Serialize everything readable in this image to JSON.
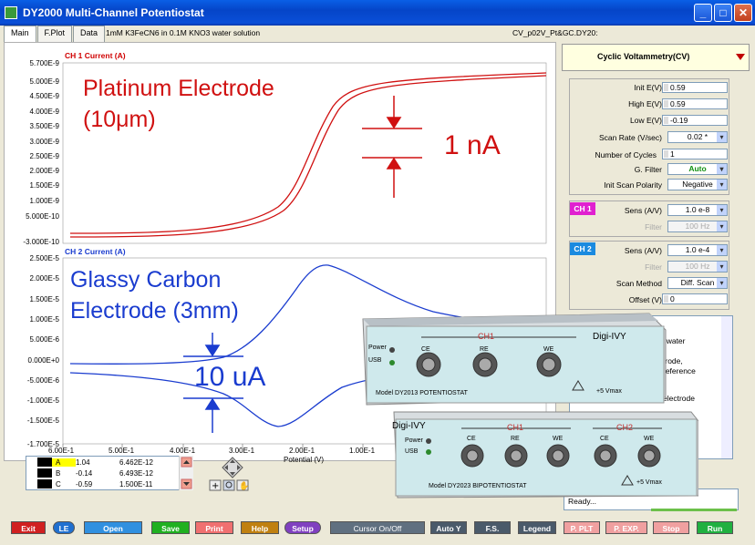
{
  "window": {
    "title": "DY2000 Multi-Channel Potentiostat"
  },
  "tabs": [
    {
      "label": "Main"
    },
    {
      "label": "F.Plot"
    },
    {
      "label": "Data"
    }
  ],
  "header": {
    "description": "1mM K3FeCN6 in 0.1M KNO3 water solution",
    "filename": "CV_p02V_Pt&GC.DY20:"
  },
  "ch1_plot": {
    "label": "CH 1   Current (A)",
    "yticks": [
      "5.700E-9",
      "5.000E-9",
      "4.500E-9",
      "4.000E-9",
      "3.500E-9",
      "3.000E-9",
      "2.500E-9",
      "2.000E-9",
      "1.500E-9",
      "1.000E-9",
      "5.000E-10",
      "-3.000E-10"
    ],
    "annotation_title_1": "Platinum Electrode",
    "annotation_title_2": "(10μm)",
    "scale_label": "1 nA"
  },
  "ch2_plot": {
    "label": "CH 2   Current (A)",
    "yticks": [
      "2.500E-5",
      "2.000E-5",
      "1.500E-5",
      "1.000E-5",
      "5.000E-6",
      "0.000E+0",
      "-5.000E-6",
      "-1.000E-5",
      "-1.500E-5",
      "-1.700E-5"
    ],
    "annotation_title_1": "Glassy Carbon",
    "annotation_title_2": "Electrode (3mm)",
    "scale_label": "10 uA"
  },
  "x_axis": {
    "ticks": [
      "6.00E-1",
      "5.00E-1",
      "4.00E-1",
      "3.00E-1",
      "2.00E-1",
      "1.00E-1"
    ],
    "label": "Potential (V)"
  },
  "cursors": [
    {
      "name": "A",
      "v1": "1.04",
      "v2": "6.462E-12"
    },
    {
      "name": "B",
      "v1": "-0.14",
      "v2": "6.493E-12"
    },
    {
      "name": "C",
      "v1": "-0.59",
      "v2": "1.500E-11"
    }
  ],
  "experiment": {
    "title": "Cyclic Voltammetry(CV)",
    "params": [
      {
        "label": "Init E(V)",
        "value": "0.59"
      },
      {
        "label": "High  E(V)",
        "value": "0.59"
      },
      {
        "label": "Low E(V)",
        "value": "-0.19"
      }
    ],
    "scan_rate_label": "Scan Rate (V/sec)",
    "scan_rate": "0.02 *",
    "cycles_label": "Number of Cycles",
    "cycles": "1",
    "gfilter_label": "G. Filter",
    "gfilter": "Auto",
    "polarity_label": "Init Scan Polarity",
    "polarity": "Negative"
  },
  "ch1_settings": {
    "badge": "CH 1",
    "sens_label": "Sens (A/V)",
    "sens": "1.0 e-8",
    "filter_label": "Filter",
    "filter": "100 Hz"
  },
  "ch2_settings": {
    "badge": "CH 2",
    "sens_label": "Sens (A/V)",
    "sens": "1.0 e-4",
    "filter_label": "Filter",
    "filter": "100 Hz",
    "method_label": "Scan Method",
    "method": "Diff. Scan",
    "offset_label": "Offset (V)",
    "offset": "0"
  },
  "notes_text": {
    "l1": "O3 water",
    "l2": "trode,",
    "l3": "reference",
    "l4": "electrode"
  },
  "status": {
    "text": "Ready..."
  },
  "devices": {
    "d1": {
      "brand": "Digi-IVY",
      "ch": "CH1",
      "ports": [
        "CE",
        "RE",
        "WE"
      ],
      "model": "Model DY2013 POTENTIOSTAT",
      "warn": "+5 Vmax",
      "power": "Power",
      "usb": "USB"
    },
    "d2": {
      "brand": "Digi-IVY",
      "ch1": "CH1",
      "ch2": "CH2",
      "ports": [
        "CE",
        "RE",
        "WE",
        "CE",
        "WE"
      ],
      "model": "Model DY2023 BIPOTENTIOSTAT",
      "warn": "+5  Vmax",
      "power": "Power",
      "usb": "USB"
    }
  },
  "buttons": [
    {
      "label": "Exit",
      "color": "#d02020"
    },
    {
      "label": "LE",
      "color": "#2070d0"
    },
    {
      "label": "Open",
      "color": "#3090e0"
    },
    {
      "label": "Save",
      "color": "#20b020"
    },
    {
      "label": "Print",
      "color": "#f07070"
    },
    {
      "label": "Help",
      "color": "#c08010"
    },
    {
      "label": "Setup",
      "color": "#8040c0"
    },
    {
      "label": "Cursor On/Off",
      "color": "#607080"
    },
    {
      "label": "Auto Y",
      "color": "#4a5a6a"
    },
    {
      "label": "F.S.",
      "color": "#4a5a6a"
    },
    {
      "label": "Legend",
      "color": "#4a5a6a"
    },
    {
      "label": "P. PLT",
      "color": "#f0a0a0"
    },
    {
      "label": "P. EXP.",
      "color": "#f0a0a0"
    },
    {
      "label": "Stop",
      "color": "#f0a0a0"
    },
    {
      "label": "Run",
      "color": "#20b040"
    }
  ]
}
